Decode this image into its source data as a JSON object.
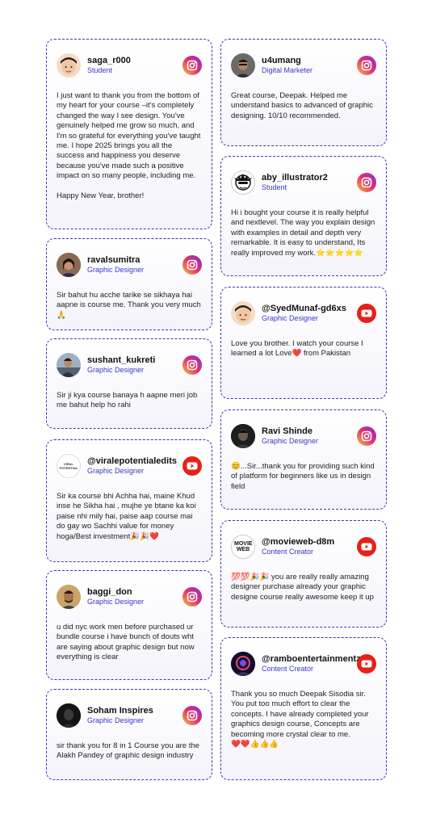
{
  "testimonials": [
    {
      "name": "saga_r000",
      "role": "Student",
      "platform": "instagram",
      "text": "I just want to thank you from the bottom of my heart for your course –it's completely changed the way I see design. You've genuinely helped me grow so much, and I'm so grateful for everything you've taught me. I hope 2025 brings you all the success and happiness you deserve because you've made such a positive impact on so many people, including me.\n\nHappy New Year, brother!"
    },
    {
      "name": "u4umang",
      "role": "Digital Marketer",
      "platform": "instagram",
      "text": "Great course, Deepak. Helped me understand basics to advanced of graphic designing. 10/10 recommended."
    },
    {
      "name": "aby_illustrator2",
      "role": "Student",
      "platform": "instagram",
      "text": "Hi i bought your course it is really helpful and nextlevel. The way you  explain design with examples in detail and depth very remarkable. It is easy to understand, Its really improved my work.⭐⭐⭐⭐⭐"
    },
    {
      "name": "ravalsumitra",
      "role": "Graphic Designer",
      "platform": "instagram",
      "text": "Sir bahut hu acche tarike se sikhaya hai aapne is course me. Thank you very much🙏"
    },
    {
      "name": "@SyedMunaf-gd6xs",
      "role": "Graphic Designer",
      "platform": "youtube",
      "text": "Love you brother. I watch your course I learned a lot Love❤️ from Pakistan"
    },
    {
      "name": "sushant_kukreti",
      "role": "Graphic Designer",
      "platform": "instagram",
      "text": "Sir ji kya course banaya h aapne meri job me bahut help ho rahi"
    },
    {
      "name": "Ravi Shinde",
      "role": "Graphic Designer",
      "platform": "instagram",
      "text": "😊...Sir...thank you for providing such kind of platform for beginners like us in design field"
    },
    {
      "name": "@viralepotentialedits",
      "role": "Graphic Designer",
      "platform": "youtube",
      "text": "Sir ka course bhi Achha hai, maine Khud inse he Sikha hai , mujhe ye btane ka koi paise nhi mily hai, paise aap course mai do gay wo Sachhi value for money hoga/Best investment🎉🎉❤️"
    },
    {
      "name": "@movieweb-d8m",
      "role": "Content Creator",
      "platform": "youtube",
      "text": "💯💯🎉🎉 you are really really amazing designer purchase already your graphic designe course really awesome keep it up"
    },
    {
      "name": "baggi_don",
      "role": "Graphic Designer",
      "platform": "instagram",
      "text": "u did nyc work men before purchased ur bundle course i have bunch of douts wht are saying about graphic design but now everything is clear"
    },
    {
      "name": "@ramboentertainmentz",
      "role": "Content Creator",
      "platform": "youtube",
      "text": "Thank you so much Deepak Sisodia sir. You put too much effort to clear the concepts. I have already completed your graphics design course, Concepts are becoming more crystal clear to me.\n❤️❤️👍👍👍"
    },
    {
      "name": "Soham Inspires",
      "role": "Graphic Designer",
      "platform": "instagram",
      "text": "sir thank you for 8 in 1 Course you are the Alakh Pandey of graphic design industry"
    }
  ],
  "avatar_labels": {
    "viral": "VIRAL POTENTIAL",
    "movieweb": "MOVIE WEB"
  },
  "colors": {
    "border": "#3b36b8",
    "role": "#3a36c8",
    "youtube": "#e62117",
    "instagram_start": "#f9c33b",
    "instagram_end": "#8e2ad6"
  }
}
